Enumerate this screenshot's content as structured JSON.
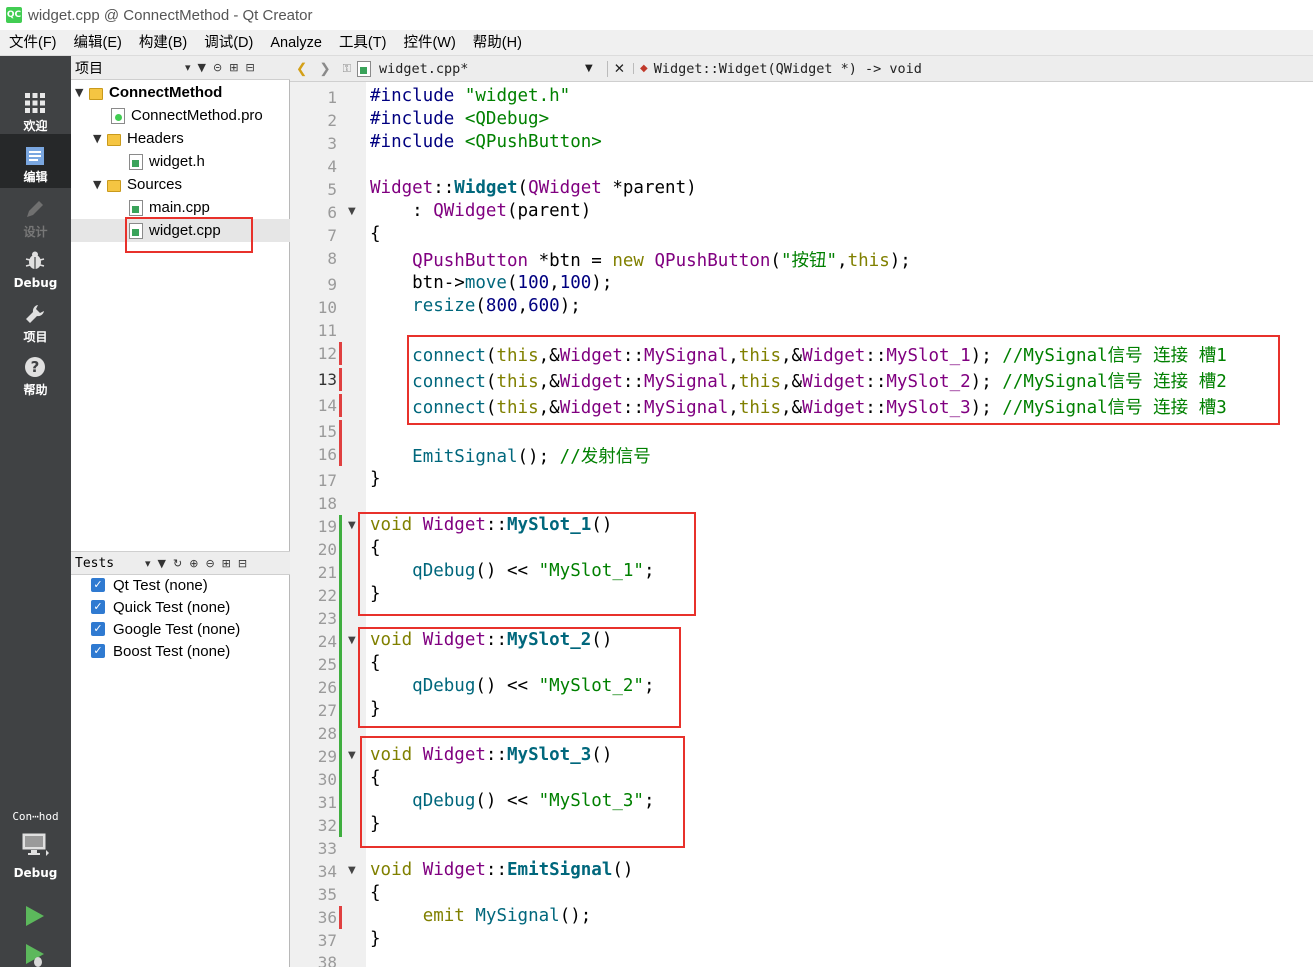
{
  "window": {
    "title": "widget.cpp @ ConnectMethod - Qt Creator",
    "app_icon": "QC"
  },
  "menu": [
    "文件(F)",
    "编辑(E)",
    "构建(B)",
    "调试(D)",
    "Analyze",
    "工具(T)",
    "控件(W)",
    "帮助(H)"
  ],
  "modes": [
    {
      "label": "欢迎",
      "icon": "grid-icon"
    },
    {
      "label": "编辑",
      "icon": "edit-icon"
    },
    {
      "label": "设计",
      "icon": "pencil-icon"
    },
    {
      "label": "Debug",
      "icon": "bug-icon"
    },
    {
      "label": "项目",
      "icon": "wrench-icon"
    },
    {
      "label": "帮助",
      "icon": "help-icon"
    }
  ],
  "kit": {
    "project": "Con⋯hod",
    "build": "Debug"
  },
  "projects_pane": {
    "title": "项目",
    "tree": [
      {
        "label": "ConnectMethod",
        "level": 0,
        "type": "project",
        "bold": true
      },
      {
        "label": "ConnectMethod.pro",
        "level": 1,
        "type": "pro"
      },
      {
        "label": "Headers",
        "level": 1,
        "type": "folder"
      },
      {
        "label": "widget.h",
        "level": 2,
        "type": "file"
      },
      {
        "label": "Sources",
        "level": 1,
        "type": "folder"
      },
      {
        "label": "main.cpp",
        "level": 2,
        "type": "file"
      },
      {
        "label": "widget.cpp",
        "level": 2,
        "type": "file",
        "selected": true
      }
    ]
  },
  "tests_pane": {
    "title": "Tests",
    "items": [
      "Qt Test (none)",
      "Quick Test (none)",
      "Google Test (none)",
      "Boost Test (none)"
    ]
  },
  "editor": {
    "file": "widget.cpp*",
    "symbol": "Widget::Widget(QWidget *) -> void",
    "current_line": 13,
    "lines": [
      "#include \"widget.h\"",
      "#include <QDebug>",
      "#include <QPushButton>",
      "",
      "Widget::Widget(QWidget *parent)",
      "    : QWidget(parent)",
      "{",
      "    QPushButton *btn = new QPushButton(\"按钮\",this);",
      "    btn->move(100,100);",
      "    resize(800,600);",
      "",
      "    connect(this,&Widget::MySignal,this,&Widget::MySlot_1); //MySignal信号 连接 槽1",
      "    connect(this,&Widget::MySignal,this,&Widget::MySlot_2); //MySignal信号 连接 槽2",
      "    connect(this,&Widget::MySignal,this,&Widget::MySlot_3); //MySignal信号 连接 槽3",
      "",
      "    EmitSignal(); //发射信号",
      "}",
      "",
      "void Widget::MySlot_1()",
      "{",
      "    qDebug() << \"MySlot_1\";",
      "}",
      "",
      "void Widget::MySlot_2()",
      "{",
      "    qDebug() << \"MySlot_2\";",
      "}",
      "",
      "void Widget::MySlot_3()",
      "{",
      "    qDebug() << \"MySlot_3\";",
      "}",
      "",
      "void Widget::EmitSignal()",
      "{",
      "     emit MySignal();",
      "}",
      ""
    ]
  },
  "colors": {
    "highlight": "#e8312b",
    "keyword": "#808000",
    "type": "#800080",
    "function": "#00677c",
    "string": "#008000"
  }
}
